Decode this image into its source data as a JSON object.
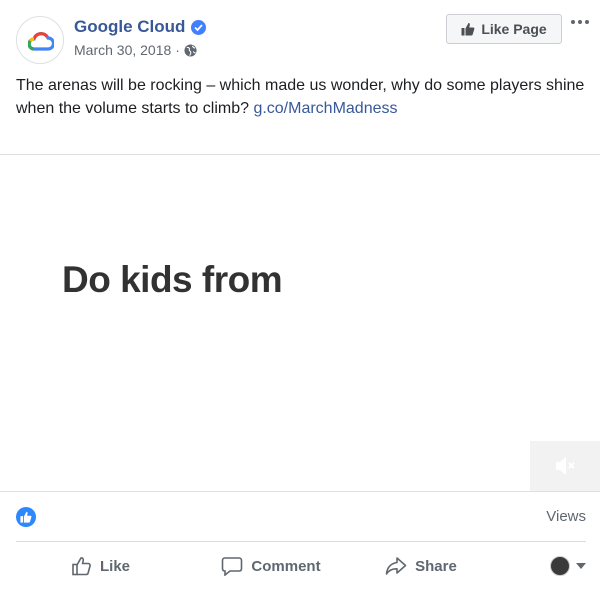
{
  "post": {
    "page_name": "Google Cloud",
    "date": "March 30, 2018",
    "meta_separator": "·",
    "like_page_label": "Like Page",
    "text_body": "The arenas will be rocking – which made us wonder, why do some players shine when the volume starts to climb? ",
    "link_text": "g.co/MarchMadness"
  },
  "media": {
    "overlay_text": "Do kids from",
    "muted": true
  },
  "stats": {
    "views_label": "Views"
  },
  "actions": {
    "like_label": "Like",
    "comment_label": "Comment",
    "share_label": "Share"
  },
  "colors": {
    "link": "#385898",
    "reaction_blue": "#2d88ff",
    "verified": "#4080ff"
  },
  "icons": [
    "google-cloud-logo",
    "verified-badge-icon",
    "globe-icon",
    "thumbs-up-icon",
    "more-options-icon",
    "mute-icon",
    "comment-icon",
    "share-icon",
    "chevron-down-icon"
  ]
}
